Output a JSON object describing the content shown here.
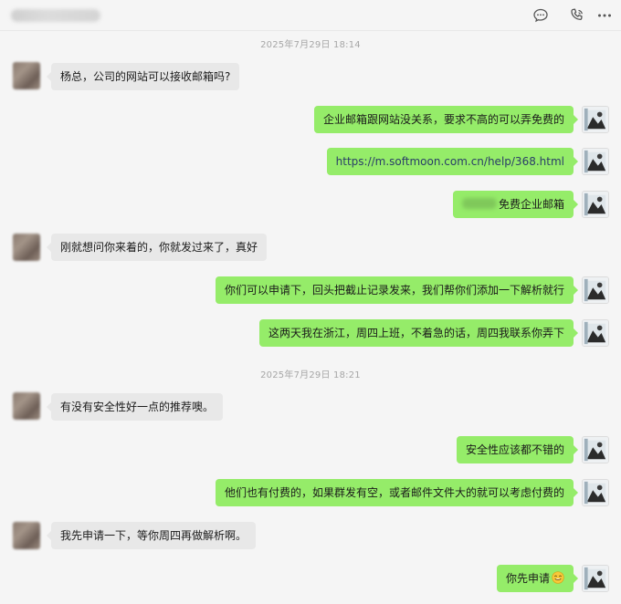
{
  "header": {
    "actions": [
      {
        "icon": "chat-bubble-icon"
      },
      {
        "icon": "phone-icon"
      },
      {
        "icon": "more-icon"
      }
    ]
  },
  "timestamps": [
    "2025年7月29日 18:14",
    "2025年7月29日 18:21"
  ],
  "messages": [
    {
      "side": "in",
      "text": "杨总，公司的网站可以接收邮箱吗?"
    },
    {
      "side": "out",
      "text": "企业邮箱跟网站没关系，要求不高的可以弄免费的"
    },
    {
      "side": "out",
      "text": "https://m.softmoon.com.cn/help/368.html"
    },
    {
      "side": "out",
      "text": "免费企业邮箱"
    },
    {
      "side": "in",
      "text": "刚就想问你来着的，你就发过来了，真好"
    },
    {
      "side": "out",
      "text": "你们可以申请下，回头把截止记录发来，我们帮你们添加一下解析就行"
    },
    {
      "side": "out",
      "text": "这两天我在浙江，周四上班，不着急的话，周四我联系你弄下"
    },
    {
      "side": "in",
      "text": "有没有安全性好一点的推荐噢。"
    },
    {
      "side": "out",
      "text": "安全性应该都不错的"
    },
    {
      "side": "out",
      "text": "他们也有付费的，如果群发有空，或者邮件文件大的就可以考虑付费的"
    },
    {
      "side": "in",
      "text": "我先申请一下，等你周四再做解析啊。"
    },
    {
      "side": "out",
      "text": "你先申请"
    }
  ]
}
